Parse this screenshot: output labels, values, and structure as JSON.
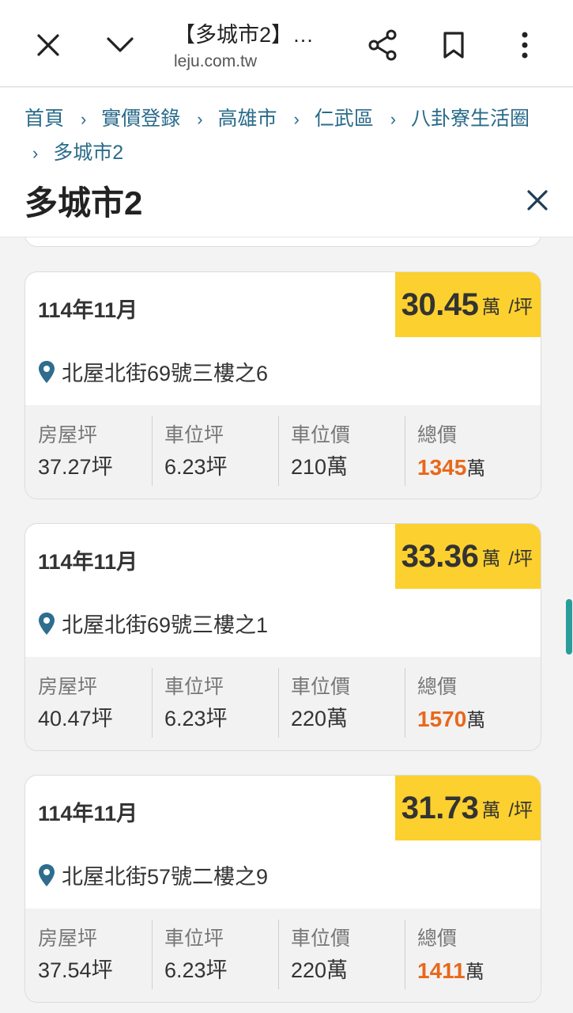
{
  "browser": {
    "title": "【多城市2】…",
    "url": "leju.com.tw"
  },
  "breadcrumb": [
    "首頁",
    "實價登錄",
    "高雄市",
    "仁武區",
    "八卦寮生活圈",
    "多城市2"
  ],
  "page_title": "多城市2",
  "price_unit": "萬",
  "price_per": "/坪",
  "stat_labels": {
    "house_ping": "房屋坪",
    "parking_ping": "車位坪",
    "parking_price": "車位價",
    "total_price": "總價"
  },
  "total_unit": "萬",
  "listings": [
    {
      "date": "114年11月",
      "unit_price": "30.45",
      "address": "北屋北街69號三樓之6",
      "house_ping": "37.27坪",
      "parking_ping": "6.23坪",
      "parking_price": "210萬",
      "total_price": "1345"
    },
    {
      "date": "114年11月",
      "unit_price": "33.36",
      "address": "北屋北街69號三樓之1",
      "house_ping": "40.47坪",
      "parking_ping": "6.23坪",
      "parking_price": "220萬",
      "total_price": "1570"
    },
    {
      "date": "114年11月",
      "unit_price": "31.73",
      "address": "北屋北街57號二樓之9",
      "house_ping": "37.54坪",
      "parking_ping": "6.23坪",
      "parking_price": "220萬",
      "total_price": "1411"
    }
  ],
  "colors": {
    "accent_link": "#2a6b8a",
    "price_highlight": "#fcd02e",
    "total_price": "#e8681a",
    "scrollbar": "#2a9d9a"
  }
}
